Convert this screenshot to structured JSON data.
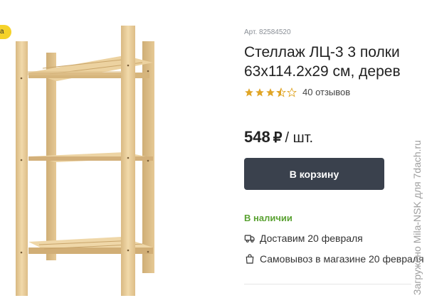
{
  "badge": {
    "label": "а"
  },
  "product": {
    "sku": "Арт. 82584520",
    "title_line1": "Стеллаж ЛЦ-3 3 полки",
    "title_line2": "63x114.2x29 см, дерев",
    "rating": 3.5,
    "reviews": "40 отзывов",
    "price_value": "548",
    "price_currency": "₽",
    "price_unit": "/ шт.",
    "cart_button": "В корзину",
    "availability": "В наличии",
    "delivery": "Доставим 20 февраля",
    "pickup": "Самовывоз в магазине 20 февраля"
  },
  "watermark": "Загружено Mila-NSK для 7dach.ru",
  "colors": {
    "badge": "#f5d22a",
    "button": "#3a414d",
    "star": "#e0a526",
    "availability": "#5aa232",
    "wood": "#e9cd9a"
  },
  "icons": [
    "star-icon",
    "truck-icon",
    "bag-icon"
  ]
}
